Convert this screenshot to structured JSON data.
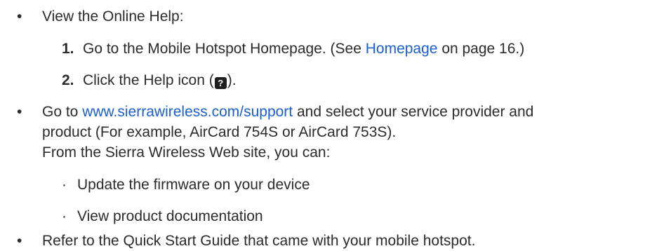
{
  "bullet_char": "•",
  "sub_bullet_char": "·",
  "items": [
    {
      "text": "View the Online Help:"
    },
    {
      "text": "Go to",
      "link": "www.sierrawireless.com/support",
      "text_after_link": "and select your service provider and",
      "line2": "product (For example, AirCard 754S or AirCard 753S).",
      "line3": "From the Sierra Wireless Web site, you can:"
    },
    {
      "text": "Refer to the Quick Start Guide that came with your mobile hotspot."
    }
  ],
  "steps": [
    {
      "number": "1.",
      "text_before": "Go to the Mobile Hotspot Homepage. (See",
      "link": "Homepage",
      "text_after": "on page 16.)"
    },
    {
      "number": "2.",
      "text_before": "Click the Help icon (",
      "icon_glyph": "?",
      "text_after": ")."
    }
  ],
  "sub_items": [
    {
      "text": "Update the firmware on your device"
    },
    {
      "text": "View product documentation"
    }
  ],
  "colors": {
    "text": "#2b2b2b",
    "link": "#1a5fd0"
  }
}
